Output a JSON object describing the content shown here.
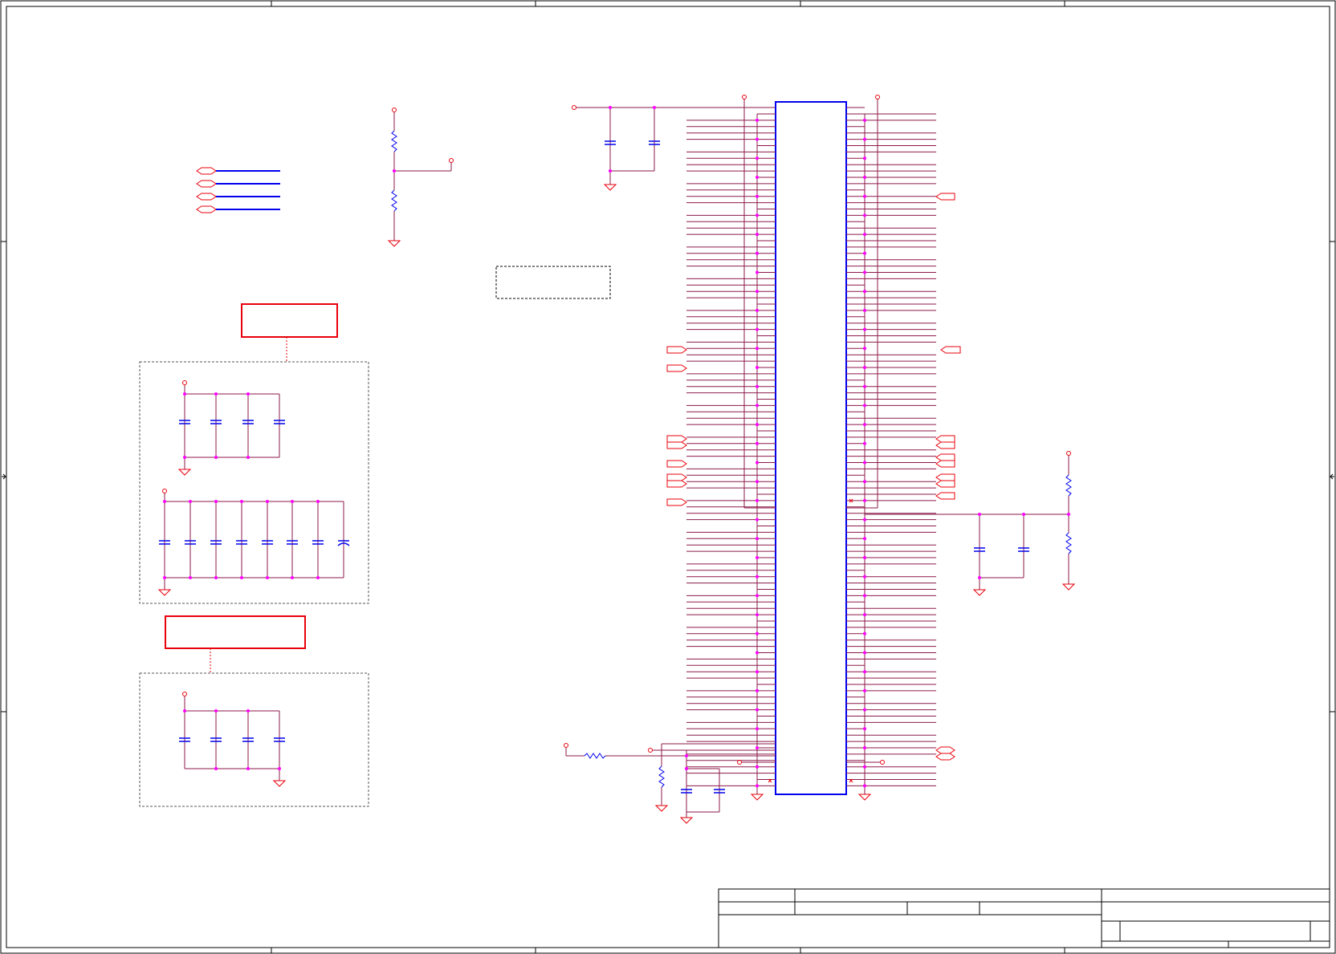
{
  "sheet": {
    "title": "",
    "title_block": {
      "title": "",
      "size": "",
      "document_number": "",
      "revision": "",
      "date": "",
      "sheet": ""
    }
  },
  "colors": {
    "border": "#000000",
    "wire": "#8b1a4a",
    "power": "#e8000b",
    "component": "#0000ee",
    "junction": "#ff00ff",
    "annotation": "#ff0000",
    "group_border": "#555555"
  },
  "symbols": {
    "ground": "ground-symbol",
    "power_port": "power-port-circle",
    "capacitor": "capacitor-symbol",
    "resistor": "resistor-symbol",
    "net_port": "hierarchical-port",
    "chip": "ic-package"
  }
}
